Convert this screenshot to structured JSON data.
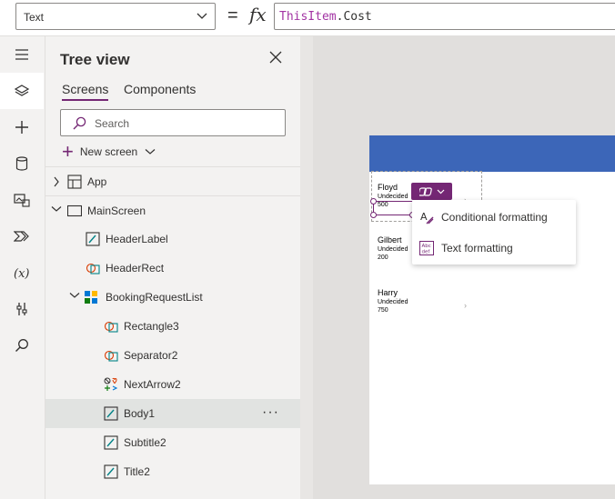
{
  "formula_bar": {
    "property": "Text",
    "equals": "=",
    "fx": "fx",
    "formula_keyword": "ThisItem",
    "formula_rest": ".Cost"
  },
  "tree_view": {
    "title": "Tree view",
    "tabs": [
      "Screens",
      "Components"
    ],
    "search_placeholder": "Search",
    "new_screen_label": "New screen",
    "nodes": {
      "app": "App",
      "main_screen": "MainScreen",
      "header_label": "HeaderLabel",
      "header_rect": "HeaderRect",
      "booking_list": "BookingRequestList",
      "rectangle3": "Rectangle3",
      "separator2": "Separator2",
      "next_arrow2": "NextArrow2",
      "body1": "Body1",
      "subtitle2": "Subtitle2",
      "title2": "Title2"
    },
    "more_label": "···"
  },
  "canvas": {
    "items": [
      {
        "title": "Floyd",
        "subtitle": "Undecided",
        "body": "500"
      },
      {
        "title": "Gilbert",
        "subtitle": "Undecided",
        "body": "200"
      },
      {
        "title": "Harry",
        "subtitle": "Undecided",
        "body": "750"
      }
    ],
    "menu": {
      "conditional_formatting": "Conditional formatting",
      "text_formatting": "Text formatting"
    },
    "accent": "#742774",
    "header_color": "#3c66b8"
  }
}
